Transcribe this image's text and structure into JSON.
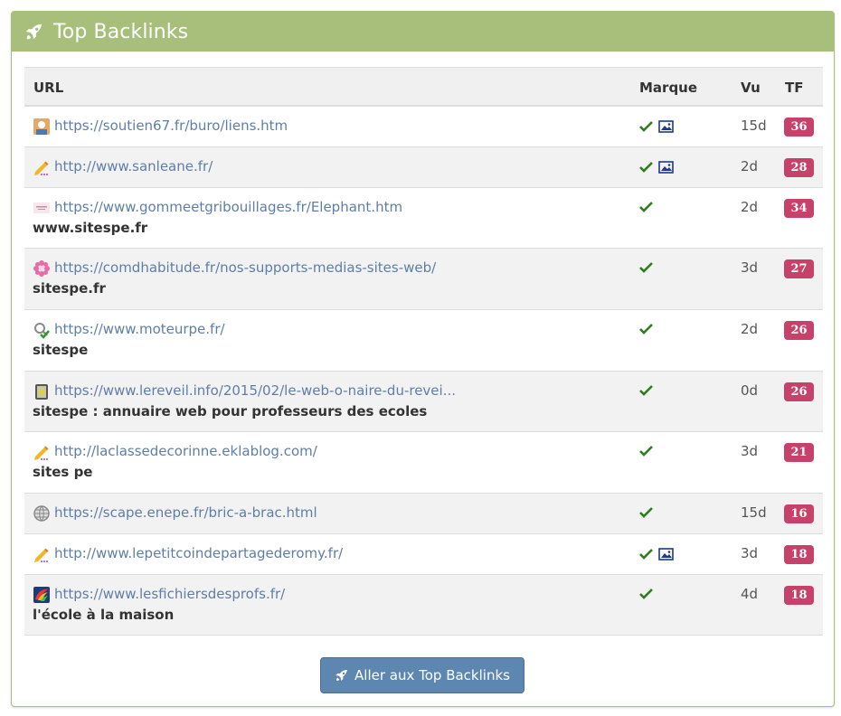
{
  "panel": {
    "title": "Top Backlinks"
  },
  "table": {
    "headers": {
      "url": "URL",
      "marque": "Marque",
      "vu": "Vu",
      "tf": "TF"
    },
    "rows": [
      {
        "url": "https://soutien67.fr/buro/liens.htm",
        "anchor": "",
        "image": true,
        "vu": "15d",
        "tf": "36",
        "favicon": "avatar-icon"
      },
      {
        "url": "http://www.sanleane.fr/",
        "anchor": "",
        "image": true,
        "vu": "2d",
        "tf": "28",
        "favicon": "pencil-icon"
      },
      {
        "url": "https://www.gommeetgribouillages.fr/Elephant.htm",
        "anchor": "www.sitespe.fr",
        "image": false,
        "vu": "2d",
        "tf": "34",
        "favicon": "site-logo-icon"
      },
      {
        "url": "https://comdhabitude.fr/nos-supports-medias-sites-web/",
        "anchor": "sitespe.fr",
        "image": false,
        "vu": "3d",
        "tf": "27",
        "favicon": "flower-icon"
      },
      {
        "url": "https://www.moteurpe.fr/",
        "anchor": "sitespe",
        "image": false,
        "vu": "2d",
        "tf": "26",
        "favicon": "magnifier-check-icon"
      },
      {
        "url": "https://www.lereveil.info/2015/02/le-web-o-naire-du-revei...",
        "anchor": "sitespe : annuaire web pour professeurs des ecoles",
        "image": false,
        "vu": "0d",
        "tf": "26",
        "favicon": "lantern-icon"
      },
      {
        "url": "http://laclassedecorinne.eklablog.com/",
        "anchor": "sites pe",
        "image": false,
        "vu": "3d",
        "tf": "21",
        "favicon": "pencil-icon"
      },
      {
        "url": "https://scape.enepe.fr/bric-a-brac.html",
        "anchor": "",
        "image": false,
        "vu": "15d",
        "tf": "16",
        "favicon": "globe-icon"
      },
      {
        "url": "http://www.lepetitcoindepartagederomy.fr/",
        "anchor": "",
        "image": true,
        "vu": "3d",
        "tf": "18",
        "favicon": "pencil-icon"
      },
      {
        "url": "https://www.lesfichiersdesprofs.fr/",
        "anchor": "l'école à la maison",
        "image": false,
        "vu": "4d",
        "tf": "18",
        "favicon": "colorful-logo-icon"
      }
    ]
  },
  "button": {
    "label": "Aller aux Top Backlinks"
  },
  "colors": {
    "header": "#a7bf7b",
    "link": "#5f7ea6",
    "tf_badge": "#c7426a",
    "check": "#2e7d1f",
    "button": "#5d87b1"
  }
}
